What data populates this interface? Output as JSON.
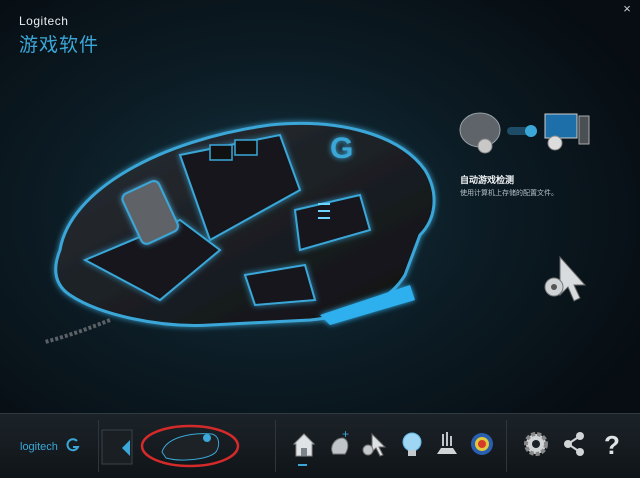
{
  "app": {
    "brand": "Logitech",
    "title": "游戏软件",
    "close_glyph": "×"
  },
  "autodetect": {
    "title": "自动游戏检测",
    "description": "使用计算机上存储的配置文件。"
  },
  "footer": {
    "logo_text": "logitech"
  },
  "nav_icons": [
    "home-icon",
    "customize-buttons-icon",
    "pointer-settings-icon",
    "lighting-icon",
    "surface-tuning-icon",
    "heatmap-icon",
    "settings-gear-icon",
    "share-icon",
    "help-icon"
  ],
  "colors": {
    "accent": "#3aa7d8",
    "background": "#0b1116",
    "highlight_circle": "#d42a2a"
  }
}
